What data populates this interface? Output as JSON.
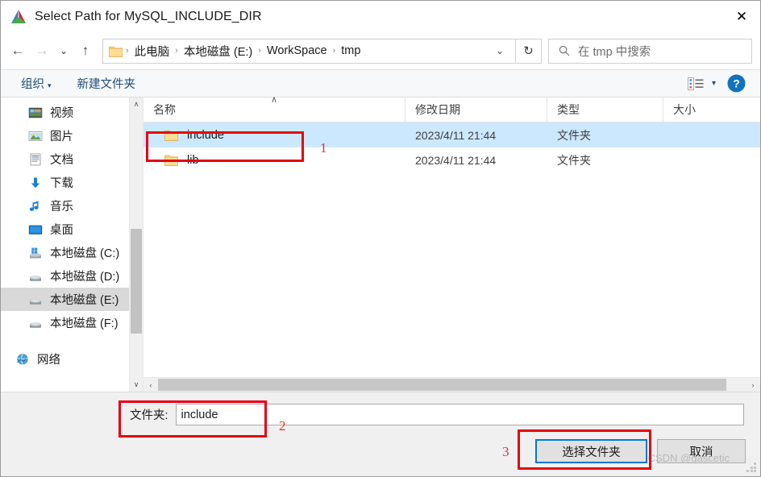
{
  "window": {
    "title": "Select Path for MySQL_INCLUDE_DIR",
    "app_icon": "cmake-icon",
    "close_label": "✕"
  },
  "nav": {
    "back": "←",
    "forward": "→",
    "recent": "⌄",
    "up": "↑",
    "refresh": "↻",
    "dropdown": "⌄",
    "breadcrumb": [
      "此电脑",
      "本地磁盘 (E:)",
      "WorkSpace",
      "tmp"
    ],
    "separator": "›"
  },
  "search": {
    "placeholder": "在 tmp 中搜索",
    "icon": "search-icon"
  },
  "commandbar": {
    "organize": "组织",
    "organize_caret": "▾",
    "new_folder": "新建文件夹",
    "view_caret": "▾",
    "help": "?"
  },
  "sidebar": {
    "items": [
      {
        "label": "视频",
        "icon": "videos-icon",
        "selected": false
      },
      {
        "label": "图片",
        "icon": "pictures-icon",
        "selected": false
      },
      {
        "label": "文档",
        "icon": "documents-icon",
        "selected": false
      },
      {
        "label": "下载",
        "icon": "downloads-icon",
        "selected": false
      },
      {
        "label": "音乐",
        "icon": "music-icon",
        "selected": false
      },
      {
        "label": "桌面",
        "icon": "desktop-icon",
        "selected": false
      },
      {
        "label": "本地磁盘 (C:)",
        "icon": "system-drive-icon",
        "selected": false
      },
      {
        "label": "本地磁盘 (D:)",
        "icon": "drive-icon",
        "selected": false
      },
      {
        "label": "本地磁盘 (E:)",
        "icon": "drive-icon",
        "selected": true
      },
      {
        "label": "本地磁盘 (F:)",
        "icon": "drive-icon",
        "selected": false
      }
    ],
    "network": {
      "label": "网络",
      "icon": "network-icon"
    },
    "scroll_up": "∧",
    "scroll_down": "∨"
  },
  "filelist": {
    "columns": [
      {
        "label": "名称",
        "sorted": true,
        "sort_caret": "∧"
      },
      {
        "label": "修改日期",
        "sorted": false
      },
      {
        "label": "类型",
        "sorted": false
      },
      {
        "label": "大小",
        "sorted": false
      }
    ],
    "rows": [
      {
        "name": "include",
        "modified": "2023/4/11 21:44",
        "type": "文件夹",
        "size": "",
        "selected": true
      },
      {
        "name": "lib",
        "modified": "2023/4/11 21:44",
        "type": "文件夹",
        "size": "",
        "selected": false
      }
    ],
    "hscroll_left": "‹",
    "hscroll_right": "›"
  },
  "footer": {
    "folder_label": "文件夹:",
    "folder_value": "include",
    "select_button": "选择文件夹",
    "cancel_button": "取消",
    "watermark": "CSDN @qascetic"
  },
  "annotations": {
    "step1": "1",
    "step2": "2",
    "step3": "3"
  },
  "colors": {
    "selection": "#cce8ff",
    "accent": "#0078d7",
    "annotation": "#e60012",
    "link": "#1f4e79"
  }
}
